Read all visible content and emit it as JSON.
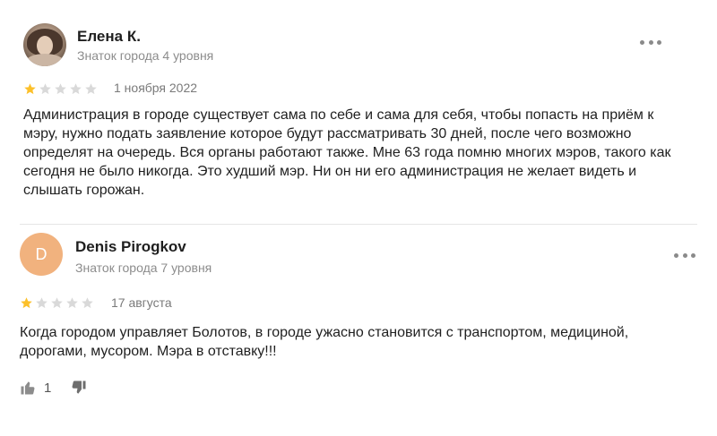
{
  "reviews": [
    {
      "author": "Елена К.",
      "level": "Знаток города 4 уровня",
      "avatar": {
        "type": "photo"
      },
      "rating": 1,
      "max_rating": 5,
      "date": "1 ноября 2022",
      "text": "Администрация в городе существует сама по себе и сама для себя, чтобы попасть на приём к мэру, нужно подать заявление которое будут рассматривать 30 дней, после чего возможно определят на очередь. Вся органы работают также. Мне 63 года помню многих мэров, такого как сегодня не было никогда. Это худший мэр. Ни он ни его администрация не желает видеть и слышать горожан."
    },
    {
      "author": "Denis Pirogkov",
      "level": "Знаток города 7 уровня",
      "avatar": {
        "type": "letter",
        "letter": "D",
        "color": "#f1b27e"
      },
      "rating": 1,
      "max_rating": 5,
      "date": "17 августа",
      "text": "Когда городом управляет Болотов, в городе ужасно становится с транспортом, медициной, дорогами, мусором. Мэра в отставку!!!",
      "likes": "1"
    }
  ],
  "icons": {
    "more": "more-icon",
    "star": "star-icon",
    "like": "thumbs-up-icon",
    "dislike": "thumbs-down-icon"
  },
  "colors": {
    "star_filled": "#fcc02a",
    "star_empty": "#d9d9d9",
    "text_primary": "#1f1f1f",
    "text_secondary": "#8c8c8c"
  }
}
